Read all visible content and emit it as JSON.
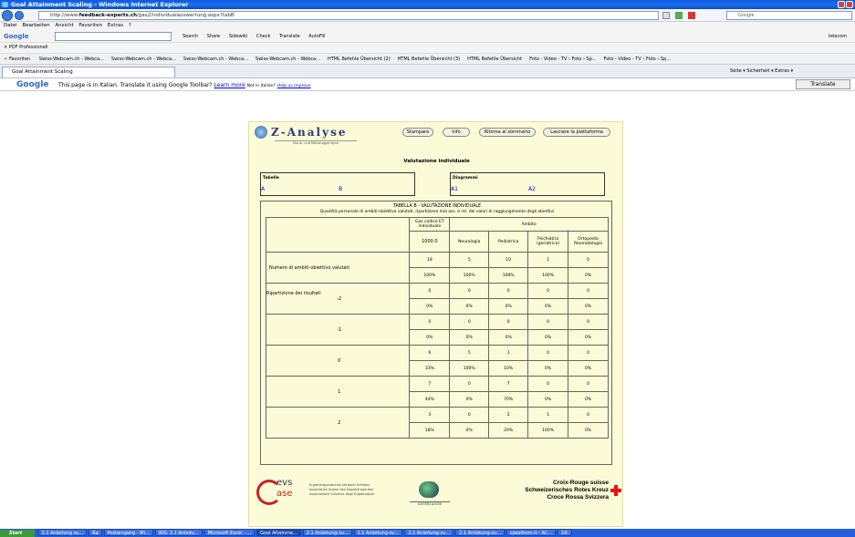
{
  "window": {
    "title": "Goal Attainment Scaling - Windows Internet Explorer"
  },
  "address": {
    "prefix": "http://www.",
    "domain": "feedback-experts.ch",
    "path": "/gas2/individualauswertung.aspx?tabB",
    "search_placeholder": "Google"
  },
  "menu": [
    "Datei",
    "Bearbeiten",
    "Ansicht",
    "Favoriten",
    "Extras",
    "?"
  ],
  "toolbar": {
    "google": "Google",
    "items": [
      "Search",
      "Share",
      "Sidewiki",
      "Check",
      "Translate",
      "AutoFill"
    ],
    "right": "telecom"
  },
  "pdfbar": {
    "label": "PDF Professionell"
  },
  "favorites": {
    "label": "Favoriten",
    "items": [
      "Swiss-Webcam.ch - Webca...",
      "Swiss-Webcam.ch - Webca...",
      "Swiss-Webcam.ch - Webca...",
      "Swiss-Webcam.ch - Webca...",
      "HTML Befehle Übersicht (2)",
      "HTML Befehle Übersicht (3)",
      "HTML Befehle Übersicht",
      "Foto - Video - TV › Foto › Sp...",
      "Foto - Video - TV › Foto › Sp..."
    ]
  },
  "tab": {
    "label": "Goal Attainment Scaling",
    "right": "Seite ▾  Sicherheit ▾  Extras ▾"
  },
  "translatebar": {
    "google": "Google",
    "text": "This page is in Italian.  Translate it using Google Toolbar?",
    "learn": "Learn more",
    "not_italian": "Not in Italian?",
    "help": "Help us improve",
    "button": "Translate"
  },
  "page": {
    "logo": "Z-Analyse",
    "logo_sub": "Mario- und Metazuggendyse",
    "buttons": [
      "Stampare",
      "Info",
      "Ritorna al sommario",
      "Lasciare la piattaforma"
    ],
    "title": "Valutazione individuale",
    "tabelle": {
      "label": "Tabelle",
      "links": [
        "A",
        "B"
      ]
    },
    "diagrammi": {
      "label": "Diagrammi",
      "links": [
        "A1",
        "A2"
      ]
    },
    "table": {
      "title": "TABELLA B - VALUTAZIONE INDIVIDUALE",
      "subtitle": "Quantità personale di ambiti-obiettivo valutati, ripartizione mia ass. e rel. dei valori di raggiungimento degli obiettivi",
      "h_gas": "Gas codice ET individuale",
      "h_ambito": "Ambito",
      "h_code": "1000.0",
      "cols": [
        "Neurologia",
        "Pediatrica",
        "Psichiatria (geriatrica)",
        "Ortopedia Reumatologia"
      ],
      "row_count_label": "Numero di ambiti-obiettivo valutati",
      "row_rip_label": "Ripartizione dei risultati",
      "count": [
        "18",
        "5",
        "10",
        "1",
        "0"
      ],
      "count_pct": [
        "100%",
        "100%",
        "100%",
        "100%",
        "0%"
      ],
      "levels": [
        {
          "label": "-2",
          "n": [
            "0",
            "0",
            "0",
            "0",
            "0"
          ],
          "p": [
            "0%",
            "0%",
            "0%",
            "0%",
            "0%"
          ]
        },
        {
          "label": "-1",
          "n": [
            "0",
            "0",
            "0",
            "0",
            "0"
          ],
          "p": [
            "0%",
            "0%",
            "0%",
            "0%",
            "0%"
          ]
        },
        {
          "label": "0",
          "n": [
            "6",
            "5",
            "1",
            "0",
            "0"
          ],
          "p": [
            "33%",
            "100%",
            "10%",
            "0%",
            "0%"
          ]
        },
        {
          "label": "1",
          "n": [
            "7",
            "0",
            "7",
            "0",
            "0"
          ],
          "p": [
            "44%",
            "0%",
            "70%",
            "0%",
            "0%"
          ]
        },
        {
          "label": "2",
          "n": [
            "3",
            "0",
            "2",
            "1",
            "0"
          ],
          "p": [
            "18%",
            "0%",
            "20%",
            "100%",
            "0%"
          ]
        }
      ]
    },
    "footer": {
      "evs": "evs",
      "ase": "ase",
      "evs_text": [
        "Ergotherapeutinnen-Verband Schweiz",
        "Association Suisse des Ergothérapeutes",
        "Associazione Svizzera degli Ergoterapisti"
      ],
      "santesuisse": "santésuisse",
      "redcross": [
        "Croix-Rouge suisse",
        "Schweizerisches Rotes Kreuz",
        "Croce Rossa Svizzera"
      ]
    }
  },
  "taskbar": {
    "start": "Start",
    "tasks": [
      "2.1 Anleitung zu...",
      "Ra",
      "Posteingang - Mi...",
      "WG: 2.1 Anleitu...",
      "Microsoft Excel - ...",
      "Goal Attainme...",
      "2.1 Anleitung-zu...",
      "2.1 Anleitung-zu...",
      "2.1 Anleitung-zu...",
      "2.1 Anleitung-zu...",
      "spesthem.it - AC...",
      "19:"
    ]
  }
}
